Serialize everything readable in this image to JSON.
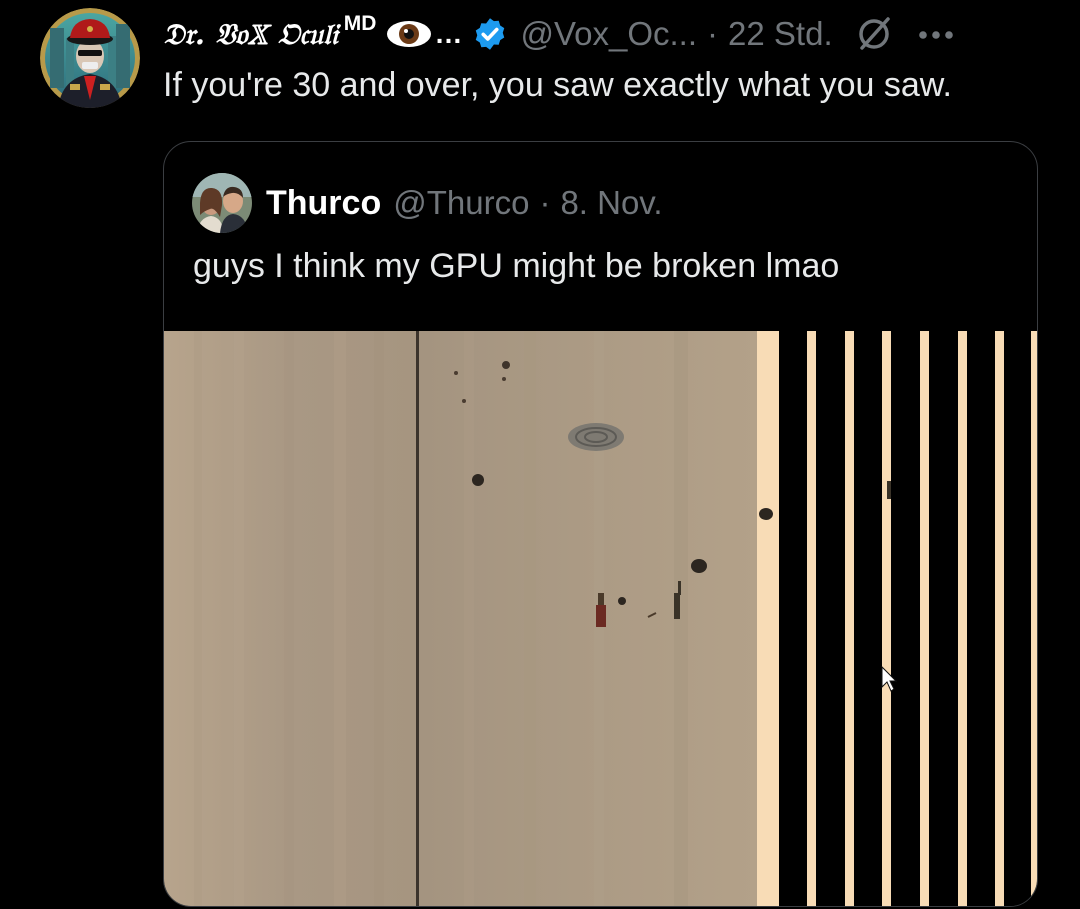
{
  "tweet": {
    "display_name": "𝔇𝔯. 𝔙𝔬𝕏 𝔒𝔠𝔲𝔩𝔦",
    "display_name_suffix": "MD",
    "display_name_ellipsis": "…",
    "handle": "@Vox_Oc...",
    "separator": "·",
    "time": "22 Std.",
    "text": "If you're 30 and over, you saw exactly what you saw.",
    "icons": [
      "avatar",
      "eye-emoji-icon",
      "verified-badge-icon",
      "grok-icon",
      "more-options-icon"
    ]
  },
  "quoted_tweet": {
    "display_name": "Thurco",
    "handle": "@Thurco",
    "separator": "·",
    "date": "8. Nov.",
    "text": "guys I think my GPU might be broken lmao"
  },
  "colors": {
    "background": "#000000",
    "primary_text": "#e7e9ea",
    "secondary_text": "#71767b",
    "verified_blue": "#1d9bf0",
    "card_border": "#3b3e42",
    "media_sand": "#a99884",
    "media_stripe": "#f8dcb6"
  }
}
